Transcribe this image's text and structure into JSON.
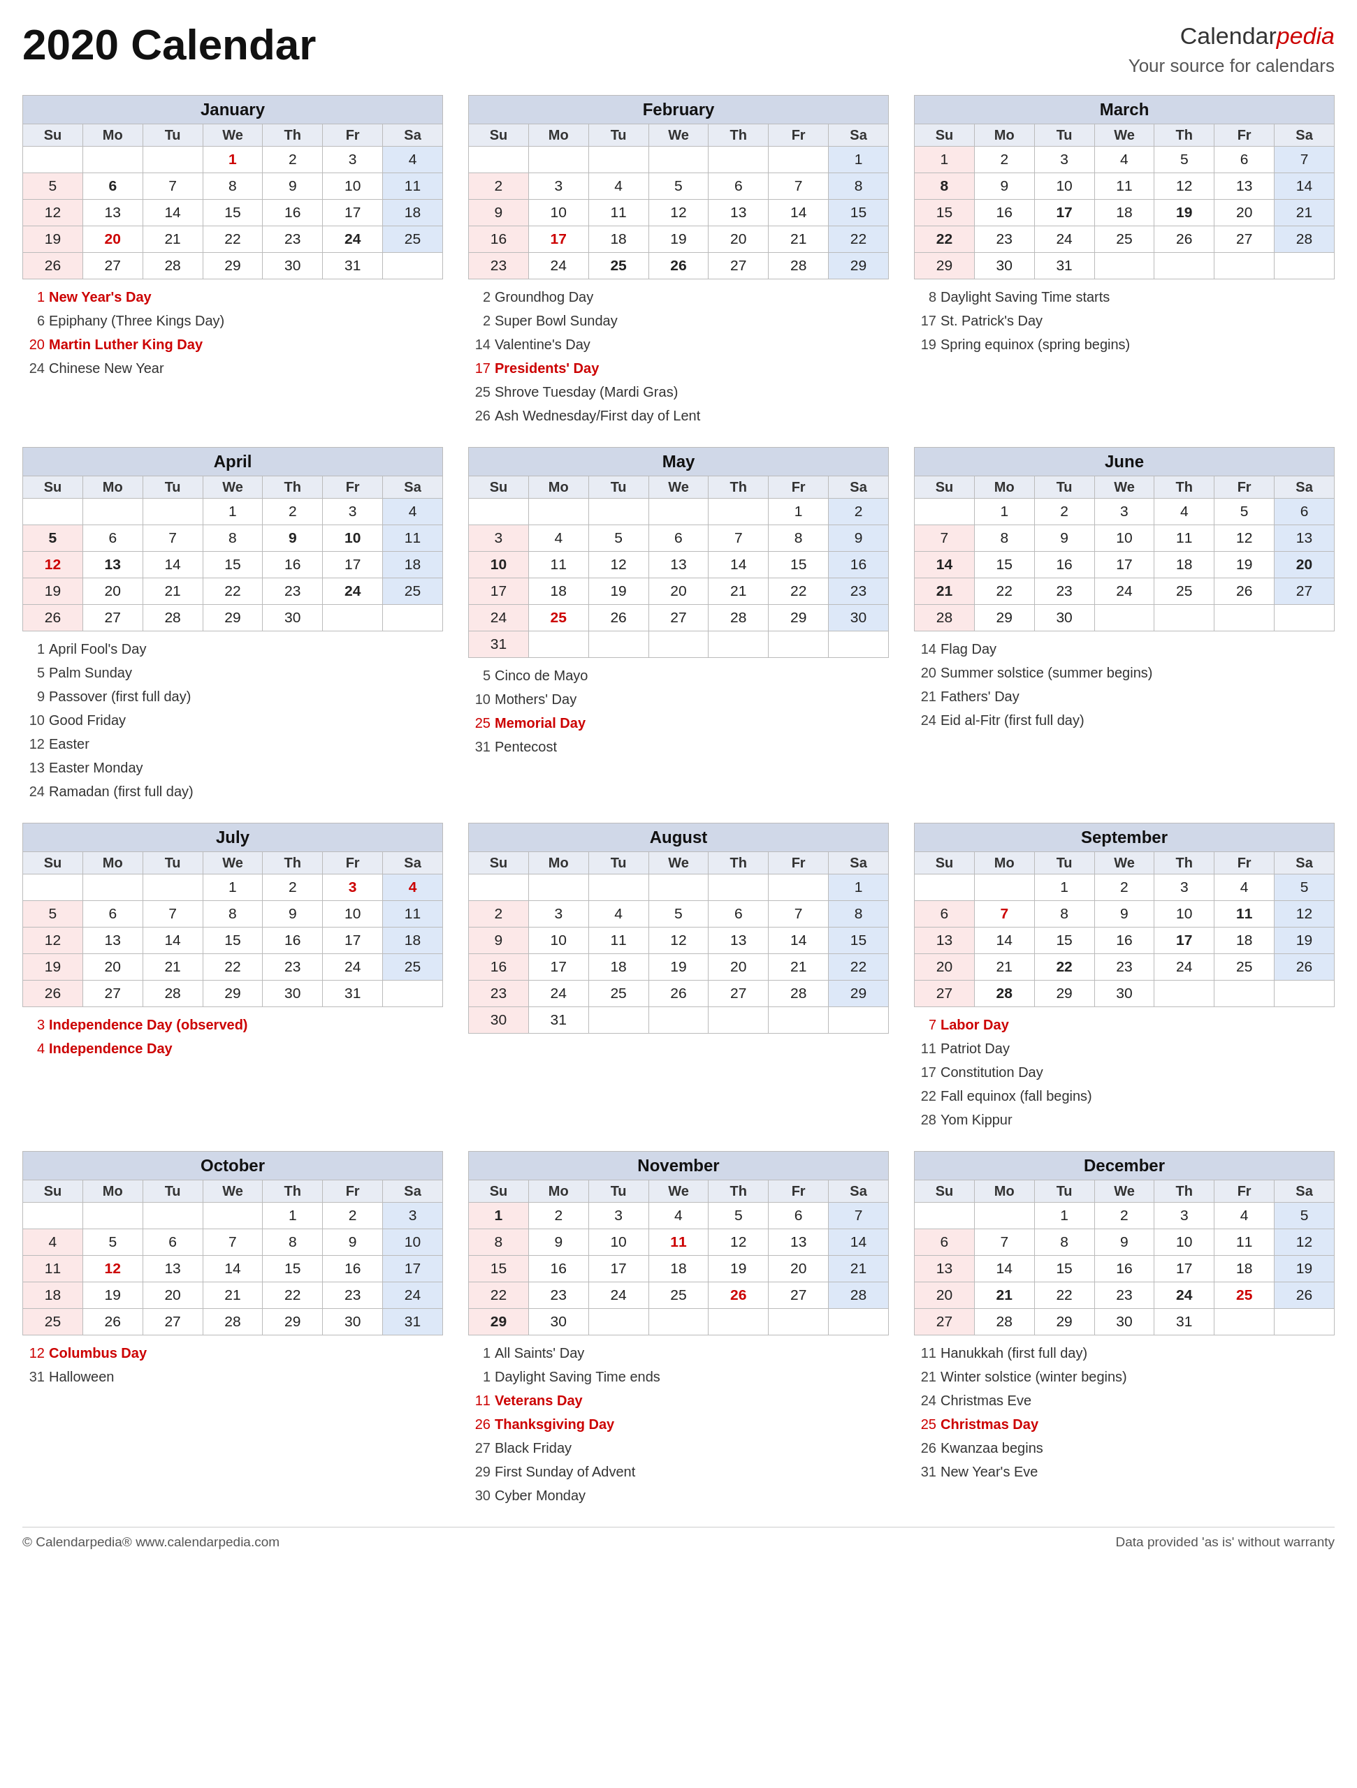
{
  "title": "2020 Calendar",
  "brand": {
    "name": "Calendarpedia",
    "tagline": "Your source for calendars",
    "url": "www.calendarpedia.com"
  },
  "footer": {
    "left": "© Calendarpedia®  www.calendarpedia.com",
    "right": "Data provided 'as is' without warranty"
  },
  "months": [
    {
      "name": "January",
      "days": [
        [
          "",
          "",
          "",
          "1",
          "2",
          "3",
          "4"
        ],
        [
          "5",
          "6",
          "7",
          "8",
          "9",
          "10",
          "11"
        ],
        [
          "12",
          "13",
          "14",
          "15",
          "16",
          "17",
          "18"
        ],
        [
          "19",
          "20",
          "21",
          "22",
          "23",
          "24",
          "25"
        ],
        [
          "26",
          "27",
          "28",
          "29",
          "30",
          "31",
          ""
        ]
      ],
      "bold": [
        "6",
        "20",
        "24"
      ],
      "red": [
        "1",
        "20"
      ],
      "holidays": [
        {
          "num": "1",
          "text": "New Year's Day",
          "red": true
        },
        {
          "num": "6",
          "text": "Epiphany (Three Kings Day)",
          "red": false
        },
        {
          "num": "20",
          "text": "Martin Luther King Day",
          "red": true
        },
        {
          "num": "24",
          "text": "Chinese New Year",
          "red": false
        }
      ]
    },
    {
      "name": "February",
      "days": [
        [
          "",
          "",
          "",
          "",
          "",
          "",
          "1"
        ],
        [
          "2",
          "3",
          "4",
          "5",
          "6",
          "7",
          "8"
        ],
        [
          "9",
          "10",
          "11",
          "12",
          "13",
          "14",
          "15"
        ],
        [
          "16",
          "17",
          "18",
          "19",
          "20",
          "21",
          "22"
        ],
        [
          "23",
          "24",
          "25",
          "26",
          "27",
          "28",
          "29"
        ]
      ],
      "bold": [
        "17",
        "25",
        "26"
      ],
      "red": [
        "17"
      ],
      "holidays": [
        {
          "num": "2",
          "text": "Groundhog Day",
          "red": false
        },
        {
          "num": "2",
          "text": "Super Bowl Sunday",
          "red": false
        },
        {
          "num": "14",
          "text": "Valentine's Day",
          "red": false
        },
        {
          "num": "17",
          "text": "Presidents' Day",
          "red": true
        },
        {
          "num": "25",
          "text": "Shrove Tuesday (Mardi Gras)",
          "red": false
        },
        {
          "num": "26",
          "text": "Ash Wednesday/First day of Lent",
          "red": false
        }
      ]
    },
    {
      "name": "March",
      "days": [
        [
          "1",
          "2",
          "3",
          "4",
          "5",
          "6",
          "7"
        ],
        [
          "8",
          "9",
          "10",
          "11",
          "12",
          "13",
          "14"
        ],
        [
          "15",
          "16",
          "17",
          "18",
          "19",
          "20",
          "21"
        ],
        [
          "22",
          "23",
          "24",
          "25",
          "26",
          "27",
          "28"
        ],
        [
          "29",
          "30",
          "31",
          "",
          "",
          "",
          ""
        ]
      ],
      "bold": [
        "8",
        "17",
        "19",
        "22"
      ],
      "red": [],
      "holidays": [
        {
          "num": "8",
          "text": "Daylight Saving Time starts",
          "red": false
        },
        {
          "num": "17",
          "text": "St. Patrick's Day",
          "red": false
        },
        {
          "num": "19",
          "text": "Spring equinox (spring begins)",
          "red": false
        }
      ]
    },
    {
      "name": "April",
      "days": [
        [
          "",
          "",
          "",
          "1",
          "2",
          "3",
          "4"
        ],
        [
          "5",
          "6",
          "7",
          "8",
          "9",
          "10",
          "11"
        ],
        [
          "12",
          "13",
          "14",
          "15",
          "16",
          "17",
          "18"
        ],
        [
          "19",
          "20",
          "21",
          "22",
          "23",
          "24",
          "25"
        ],
        [
          "26",
          "27",
          "28",
          "29",
          "30",
          "",
          ""
        ]
      ],
      "bold": [
        "5",
        "9",
        "10",
        "12",
        "13",
        "24"
      ],
      "red": [
        "12"
      ],
      "holidays": [
        {
          "num": "1",
          "text": "April Fool's Day",
          "red": false
        },
        {
          "num": "5",
          "text": "Palm Sunday",
          "red": false
        },
        {
          "num": "9",
          "text": "Passover (first full day)",
          "red": false
        },
        {
          "num": "10",
          "text": "Good Friday",
          "red": false
        },
        {
          "num": "12",
          "text": "Easter",
          "red": false
        },
        {
          "num": "13",
          "text": "Easter Monday",
          "red": false
        },
        {
          "num": "24",
          "text": "Ramadan (first full day)",
          "red": false
        }
      ]
    },
    {
      "name": "May",
      "days": [
        [
          "",
          "",
          "",
          "",
          "",
          "1",
          "2"
        ],
        [
          "3",
          "4",
          "5",
          "6",
          "7",
          "8",
          "9"
        ],
        [
          "10",
          "11",
          "12",
          "13",
          "14",
          "15",
          "16"
        ],
        [
          "17",
          "18",
          "19",
          "20",
          "21",
          "22",
          "23"
        ],
        [
          "24",
          "25",
          "26",
          "27",
          "28",
          "29",
          "30"
        ],
        [
          "31",
          "",
          "",
          "",
          "",
          "",
          ""
        ]
      ],
      "bold": [
        "10",
        "25"
      ],
      "red": [
        "25"
      ],
      "holidays": [
        {
          "num": "5",
          "text": "Cinco de Mayo",
          "red": false
        },
        {
          "num": "10",
          "text": "Mothers' Day",
          "red": false
        },
        {
          "num": "25",
          "text": "Memorial Day",
          "red": true
        },
        {
          "num": "31",
          "text": "Pentecost",
          "red": false
        }
      ]
    },
    {
      "name": "June",
      "days": [
        [
          "",
          "1",
          "2",
          "3",
          "4",
          "5",
          "6"
        ],
        [
          "7",
          "8",
          "9",
          "10",
          "11",
          "12",
          "13"
        ],
        [
          "14",
          "15",
          "16",
          "17",
          "18",
          "19",
          "20"
        ],
        [
          "21",
          "22",
          "23",
          "24",
          "25",
          "26",
          "27"
        ],
        [
          "28",
          "29",
          "30",
          "",
          "",
          "",
          ""
        ]
      ],
      "bold": [
        "14",
        "21",
        "20"
      ],
      "red": [],
      "holidays": [
        {
          "num": "14",
          "text": "Flag Day",
          "red": false
        },
        {
          "num": "20",
          "text": "Summer solstice (summer begins)",
          "red": false
        },
        {
          "num": "21",
          "text": "Fathers' Day",
          "red": false
        },
        {
          "num": "24",
          "text": "Eid al-Fitr (first full day)",
          "red": false
        }
      ]
    },
    {
      "name": "July",
      "days": [
        [
          "",
          "",
          "",
          "1",
          "2",
          "3",
          "4"
        ],
        [
          "5",
          "6",
          "7",
          "8",
          "9",
          "10",
          "11"
        ],
        [
          "12",
          "13",
          "14",
          "15",
          "16",
          "17",
          "18"
        ],
        [
          "19",
          "20",
          "21",
          "22",
          "23",
          "24",
          "25"
        ],
        [
          "26",
          "27",
          "28",
          "29",
          "30",
          "31",
          ""
        ]
      ],
      "bold": [
        "3",
        "4"
      ],
      "red": [
        "3",
        "4"
      ],
      "holidays": [
        {
          "num": "3",
          "text": "Independence Day (observed)",
          "red": true
        },
        {
          "num": "4",
          "text": "Independence Day",
          "red": true
        }
      ]
    },
    {
      "name": "August",
      "days": [
        [
          "",
          "",
          "",
          "",
          "",
          "",
          "1"
        ],
        [
          "2",
          "3",
          "4",
          "5",
          "6",
          "7",
          "8"
        ],
        [
          "9",
          "10",
          "11",
          "12",
          "13",
          "14",
          "15"
        ],
        [
          "16",
          "17",
          "18",
          "19",
          "20",
          "21",
          "22"
        ],
        [
          "23",
          "24",
          "25",
          "26",
          "27",
          "28",
          "29"
        ],
        [
          "30",
          "31",
          "",
          "",
          "",
          "",
          ""
        ]
      ],
      "bold": [],
      "red": [],
      "holidays": []
    },
    {
      "name": "September",
      "days": [
        [
          "",
          "",
          "1",
          "2",
          "3",
          "4",
          "5"
        ],
        [
          "6",
          "7",
          "8",
          "9",
          "10",
          "11",
          "12"
        ],
        [
          "13",
          "14",
          "15",
          "16",
          "17",
          "18",
          "19"
        ],
        [
          "20",
          "21",
          "22",
          "23",
          "24",
          "25",
          "26"
        ],
        [
          "27",
          "28",
          "29",
          "30",
          "",
          "",
          ""
        ]
      ],
      "bold": [
        "7",
        "11",
        "17",
        "22",
        "28"
      ],
      "red": [
        "7"
      ],
      "holidays": [
        {
          "num": "7",
          "text": "Labor Day",
          "red": true
        },
        {
          "num": "11",
          "text": "Patriot Day",
          "red": false
        },
        {
          "num": "17",
          "text": "Constitution Day",
          "red": false
        },
        {
          "num": "22",
          "text": "Fall equinox (fall begins)",
          "red": false
        },
        {
          "num": "28",
          "text": "Yom Kippur",
          "red": false
        }
      ]
    },
    {
      "name": "October",
      "days": [
        [
          "",
          "",
          "",
          "",
          "1",
          "2",
          "3"
        ],
        [
          "4",
          "5",
          "6",
          "7",
          "8",
          "9",
          "10"
        ],
        [
          "11",
          "12",
          "13",
          "14",
          "15",
          "16",
          "17"
        ],
        [
          "18",
          "19",
          "20",
          "21",
          "22",
          "23",
          "24"
        ],
        [
          "25",
          "26",
          "27",
          "28",
          "29",
          "30",
          "31"
        ]
      ],
      "bold": [
        "12"
      ],
      "red": [
        "12"
      ],
      "holidays": [
        {
          "num": "12",
          "text": "Columbus Day",
          "red": true
        },
        {
          "num": "31",
          "text": "Halloween",
          "red": false
        }
      ]
    },
    {
      "name": "November",
      "days": [
        [
          "1",
          "2",
          "3",
          "4",
          "5",
          "6",
          "7"
        ],
        [
          "8",
          "9",
          "10",
          "11",
          "12",
          "13",
          "14"
        ],
        [
          "15",
          "16",
          "17",
          "18",
          "19",
          "20",
          "21"
        ],
        [
          "22",
          "23",
          "24",
          "25",
          "26",
          "27",
          "28"
        ],
        [
          "29",
          "30",
          "",
          "",
          "",
          "",
          ""
        ]
      ],
      "bold": [
        "1",
        "11",
        "26",
        "29"
      ],
      "red": [
        "11",
        "26"
      ],
      "holidays": [
        {
          "num": "1",
          "text": "All Saints' Day",
          "red": false
        },
        {
          "num": "1",
          "text": "Daylight Saving Time ends",
          "red": false
        },
        {
          "num": "11",
          "text": "Veterans Day",
          "red": true
        },
        {
          "num": "26",
          "text": "Thanksgiving Day",
          "red": true
        },
        {
          "num": "27",
          "text": "Black Friday",
          "red": false
        },
        {
          "num": "29",
          "text": "First Sunday of Advent",
          "red": false
        },
        {
          "num": "30",
          "text": "Cyber Monday",
          "red": false
        }
      ]
    },
    {
      "name": "December",
      "days": [
        [
          "",
          "",
          "1",
          "2",
          "3",
          "4",
          "5"
        ],
        [
          "6",
          "7",
          "8",
          "9",
          "10",
          "11",
          "12"
        ],
        [
          "13",
          "14",
          "15",
          "16",
          "17",
          "18",
          "19"
        ],
        [
          "20",
          "21",
          "22",
          "23",
          "24",
          "25",
          "26"
        ],
        [
          "27",
          "28",
          "29",
          "30",
          "31",
          "",
          ""
        ]
      ],
      "bold": [
        "21",
        "24",
        "25"
      ],
      "red": [
        "25"
      ],
      "holidays": [
        {
          "num": "11",
          "text": "Hanukkah (first full day)",
          "red": false
        },
        {
          "num": "21",
          "text": "Winter solstice (winter begins)",
          "red": false
        },
        {
          "num": "24",
          "text": "Christmas Eve",
          "red": false
        },
        {
          "num": "25",
          "text": "Christmas Day",
          "red": true
        },
        {
          "num": "26",
          "text": "Kwanzaa begins",
          "red": false
        },
        {
          "num": "31",
          "text": "New Year's Eve",
          "red": false
        }
      ]
    }
  ]
}
